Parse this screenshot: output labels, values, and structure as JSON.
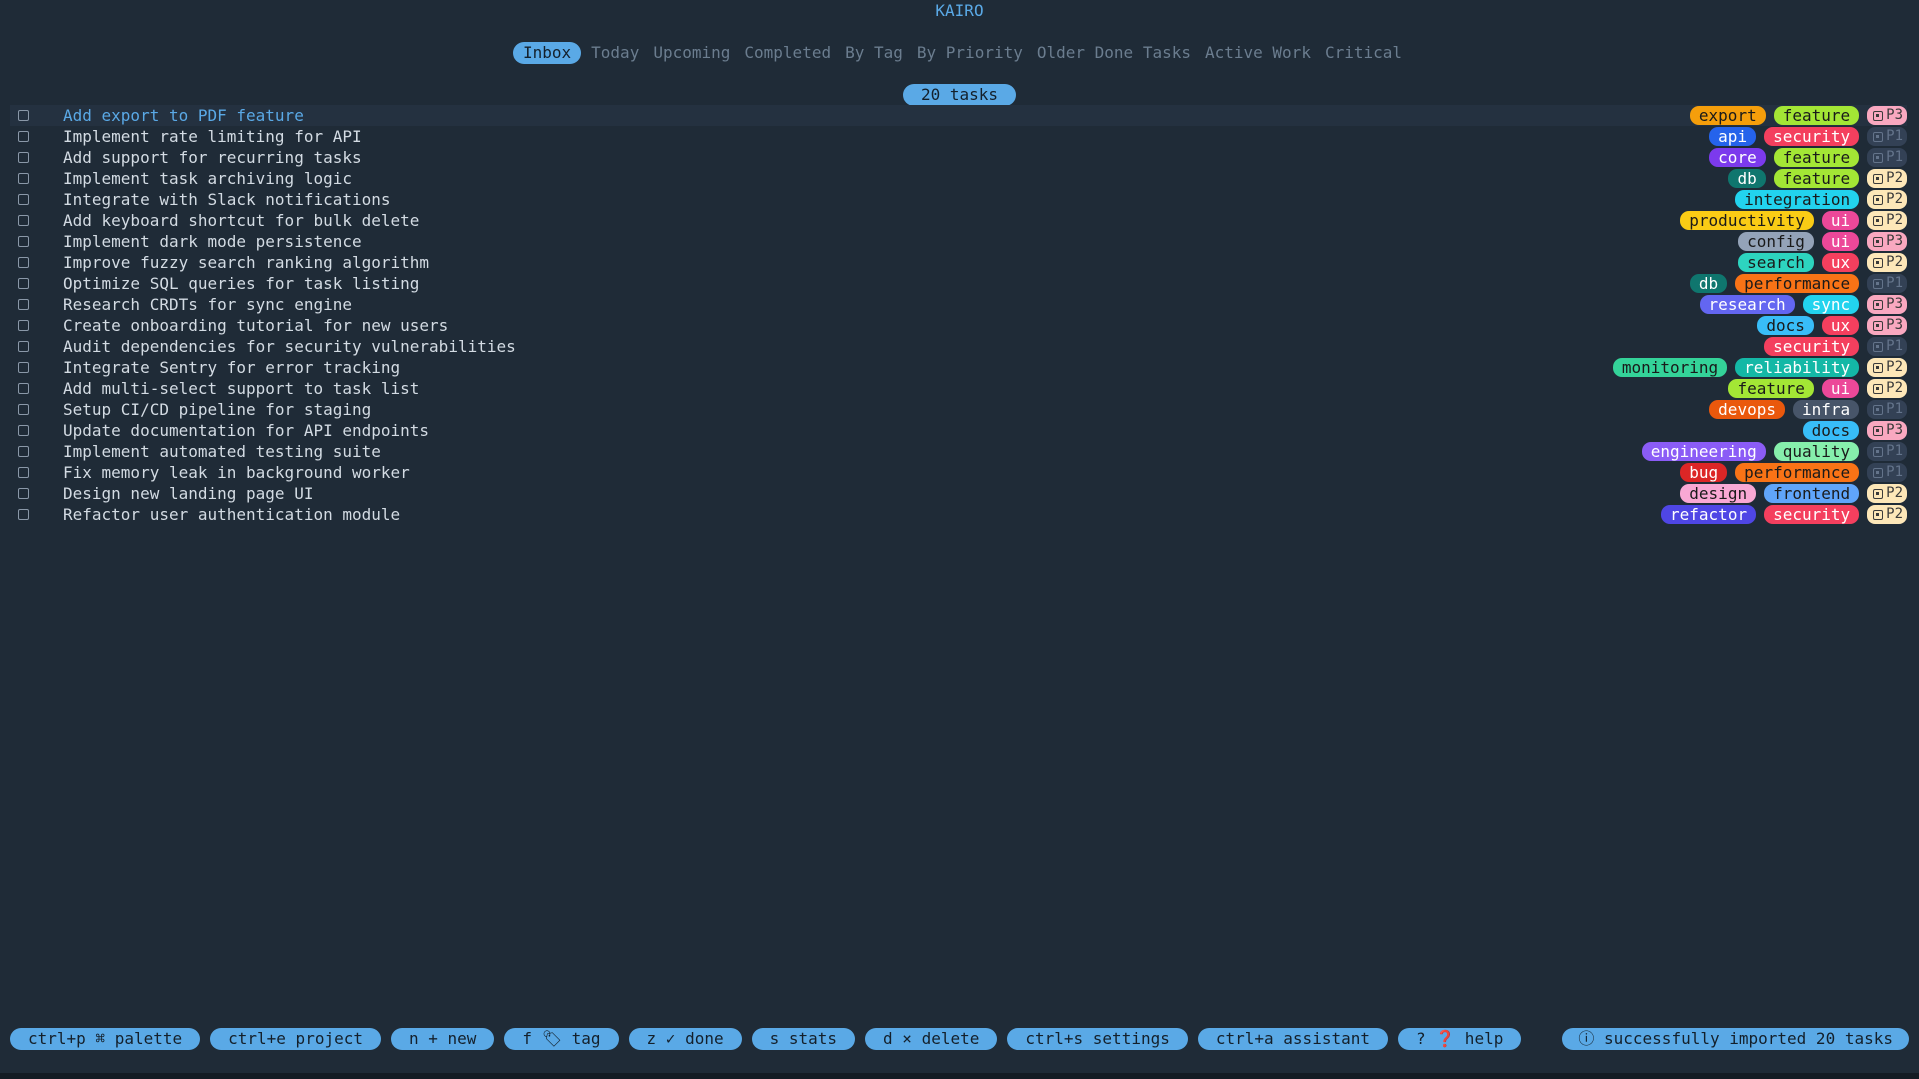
{
  "app": {
    "title": "KAIRO"
  },
  "tabs": [
    {
      "label": "Inbox",
      "active": true
    },
    {
      "label": "Today",
      "active": false
    },
    {
      "label": "Upcoming",
      "active": false
    },
    {
      "label": "Completed",
      "active": false
    },
    {
      "label": "By Tag",
      "active": false
    },
    {
      "label": "By Priority",
      "active": false
    },
    {
      "label": "Older Done Tasks",
      "active": false
    },
    {
      "label": "Active Work",
      "active": false
    },
    {
      "label": "Critical",
      "active": false
    }
  ],
  "task_count": "20 tasks",
  "tag_colors": {
    "export": "#f59e0b",
    "feature": "#a3e635",
    "api": "#2563eb",
    "security": "#f43f5e",
    "core": "#7c3aed",
    "db": "#0f766e",
    "integration": "#22d3ee",
    "productivity": "#facc15",
    "ui": "#ec4899",
    "config": "#94a3b8",
    "search": "#2dd4bf",
    "ux": "#f43f5e",
    "performance": "#f97316",
    "research": "#6366f1",
    "sync": "#22d3ee",
    "docs": "#38bdf8",
    "monitoring": "#34d399",
    "reliability": "#14b8a6",
    "devops": "#ea580c",
    "infra": "#475569",
    "engineering": "#8b5cf6",
    "quality": "#86efac",
    "bug": "#dc2626",
    "design": "#f9a8d4",
    "frontend": "#60a5fa",
    "refactor": "#4f46e5"
  },
  "tag_text_colors": {
    "export": "#1a1a1a",
    "feature": "#1a1a1a",
    "api": "#ffffff",
    "security": "#ffffff",
    "core": "#ffffff",
    "db": "#ffffff",
    "integration": "#1a1a1a",
    "productivity": "#1a1a1a",
    "ui": "#ffffff",
    "config": "#1a1a1a",
    "search": "#1a1a1a",
    "ux": "#ffffff",
    "performance": "#1a1a1a",
    "research": "#ffffff",
    "sync": "#ffffff",
    "docs": "#1a1a1a",
    "monitoring": "#1a1a1a",
    "reliability": "#ffffff",
    "devops": "#ffffff",
    "infra": "#ffffff",
    "engineering": "#ffffff",
    "quality": "#1a1a1a",
    "bug": "#ffffff",
    "design": "#1a1a1a",
    "frontend": "#1a1a1a",
    "refactor": "#ffffff"
  },
  "priority_colors": {
    "P1": {
      "bg": "#334155",
      "fg": "#64748b"
    },
    "P2": {
      "bg": "#fde7b8",
      "fg": "#3a3a3a"
    },
    "P3": {
      "bg": "#f9a8c0",
      "fg": "#3a3a3a"
    }
  },
  "tasks": [
    {
      "title": "Add export to PDF feature",
      "tags": [
        "export",
        "feature"
      ],
      "priority": "P3",
      "selected": true
    },
    {
      "title": "Implement rate limiting for API",
      "tags": [
        "api",
        "security"
      ],
      "priority": "P1"
    },
    {
      "title": "Add support for recurring tasks",
      "tags": [
        "core",
        "feature"
      ],
      "priority": "P1"
    },
    {
      "title": "Implement task archiving logic",
      "tags": [
        "db",
        "feature"
      ],
      "priority": "P2"
    },
    {
      "title": "Integrate with Slack notifications",
      "tags": [
        "integration"
      ],
      "priority": "P2"
    },
    {
      "title": "Add keyboard shortcut for bulk delete",
      "tags": [
        "productivity",
        "ui"
      ],
      "priority": "P2"
    },
    {
      "title": "Implement dark mode persistence",
      "tags": [
        "config",
        "ui"
      ],
      "priority": "P3"
    },
    {
      "title": "Improve fuzzy search ranking algorithm",
      "tags": [
        "search",
        "ux"
      ],
      "priority": "P2"
    },
    {
      "title": "Optimize SQL queries for task listing",
      "tags": [
        "db",
        "performance"
      ],
      "priority": "P1"
    },
    {
      "title": "Research CRDTs for sync engine",
      "tags": [
        "research",
        "sync"
      ],
      "priority": "P3"
    },
    {
      "title": "Create onboarding tutorial for new users",
      "tags": [
        "docs",
        "ux"
      ],
      "priority": "P3"
    },
    {
      "title": "Audit dependencies for security vulnerabilities",
      "tags": [
        "security"
      ],
      "priority": "P1"
    },
    {
      "title": "Integrate Sentry for error tracking",
      "tags": [
        "monitoring",
        "reliability"
      ],
      "priority": "P2"
    },
    {
      "title": "Add multi-select support to task list",
      "tags": [
        "feature",
        "ui"
      ],
      "priority": "P2"
    },
    {
      "title": "Setup CI/CD pipeline for staging",
      "tags": [
        "devops",
        "infra"
      ],
      "priority": "P1"
    },
    {
      "title": "Update documentation for API endpoints",
      "tags": [
        "docs"
      ],
      "priority": "P3"
    },
    {
      "title": "Implement automated testing suite",
      "tags": [
        "engineering",
        "quality"
      ],
      "priority": "P1"
    },
    {
      "title": "Fix memory leak in background worker",
      "tags": [
        "bug",
        "performance"
      ],
      "priority": "P1"
    },
    {
      "title": "Design new landing page UI",
      "tags": [
        "design",
        "frontend"
      ],
      "priority": "P2"
    },
    {
      "title": "Refactor user authentication module",
      "tags": [
        "refactor",
        "security"
      ],
      "priority": "P2"
    }
  ],
  "footer": {
    "keys": [
      {
        "label": "ctrl+p ⌘ palette",
        "name": "palette"
      },
      {
        "label": "ctrl+e project",
        "name": "project"
      },
      {
        "label": "n + new",
        "name": "new"
      },
      {
        "label": "f 🏷 tag",
        "name": "tag"
      },
      {
        "label": "z ✓ done",
        "name": "done"
      },
      {
        "label": "s stats",
        "name": "stats"
      },
      {
        "label": "d × delete",
        "name": "delete"
      },
      {
        "label": "ctrl+s settings",
        "name": "settings"
      },
      {
        "label": "ctrl+a assistant",
        "name": "assistant"
      },
      {
        "label": "? ❓ help",
        "name": "help"
      }
    ],
    "status": "ⓘ  successfully imported 20 tasks"
  }
}
